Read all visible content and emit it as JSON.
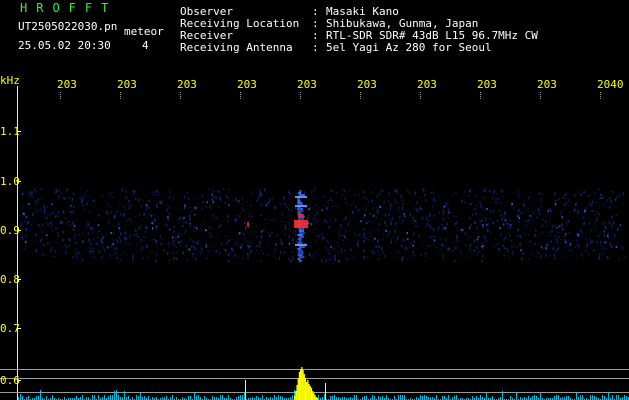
{
  "header": {
    "brand": "HROFFT",
    "filename": "UT2505022030.pn",
    "meteor_label": "meteor",
    "datetime": "25.05.02 20:30",
    "count": "4",
    "info": [
      {
        "label": "Observer",
        "sep": ":",
        "value": "Masaki Kano"
      },
      {
        "label": "Receiving Location",
        "sep": ":",
        "value": "Shibukawa, Gunma, Japan"
      },
      {
        "label": "Receiver",
        "sep": ":",
        "value": "RTL-SDR SDR# 43dB L15 96.7MHz CW"
      },
      {
        "label": "Receiving Antenna",
        "sep": ":",
        "value": "5el Yagi Az 280 for Seoul"
      }
    ]
  },
  "axes": {
    "y_unit": "kHz",
    "y_ticks": [
      "1.1",
      "1.0",
      "0.9",
      "0.8",
      "0.7",
      "0.6"
    ],
    "x_ticks": [
      "203",
      "203",
      "203",
      "203",
      "203",
      "203",
      "203",
      "203",
      "203",
      "2040"
    ]
  },
  "colors": {
    "background": "#000000",
    "text": "#ffffff",
    "accent": "#ffff00",
    "brand": "#33ee33",
    "signal_low": "#1a2a90",
    "signal_mid": "#3a6cff",
    "signal_high": "#ff3030",
    "spectrum": "#00d8ff",
    "burst": "#ffff00"
  }
}
